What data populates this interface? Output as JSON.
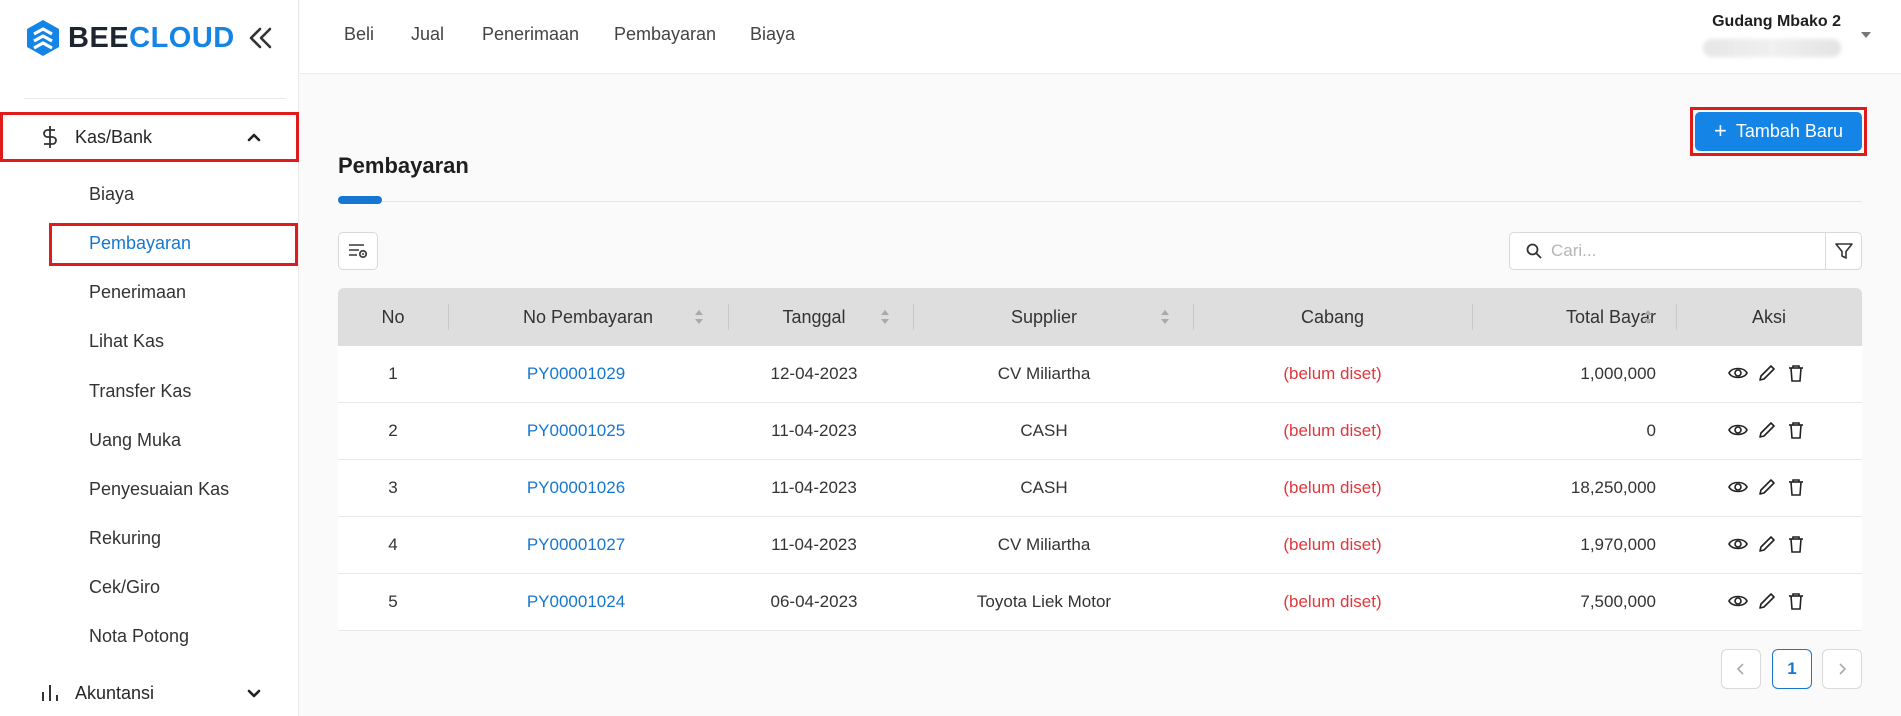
{
  "brand": {
    "part1": "BEE",
    "part2": "CLOUD"
  },
  "sidebar": {
    "kas_bank": {
      "label": "Kas/Bank",
      "icon": "dollar-icon"
    },
    "items": [
      {
        "label": "Biaya"
      },
      {
        "label": "Pembayaran"
      },
      {
        "label": "Penerimaan"
      },
      {
        "label": "Lihat Kas"
      },
      {
        "label": "Transfer Kas"
      },
      {
        "label": "Uang Muka"
      },
      {
        "label": "Penyesuaian Kas"
      },
      {
        "label": "Rekuring"
      },
      {
        "label": "Cek/Giro"
      },
      {
        "label": "Nota Potong"
      }
    ],
    "akuntansi": {
      "label": "Akuntansi",
      "icon": "bar-chart-icon"
    }
  },
  "topnav": {
    "items": [
      "Beli",
      "Jual",
      "Penerimaan",
      "Pembayaran",
      "Biaya"
    ],
    "user_name": "Gudang Mbako 2"
  },
  "page": {
    "title": "Pembayaran",
    "add_button": "Tambah Baru",
    "search_placeholder": "Cari..."
  },
  "table": {
    "headers": [
      "No",
      "No Pembayaran",
      "Tanggal",
      "Supplier",
      "Cabang",
      "Total Bayar",
      "Aksi"
    ],
    "rows": [
      {
        "no": "1",
        "code": "PY00001029",
        "date": "12-04-2023",
        "supplier": "CV Miliartha",
        "cabang": "(belum diset)",
        "total": "1,000,000"
      },
      {
        "no": "2",
        "code": "PY00001025",
        "date": "11-04-2023",
        "supplier": "CASH",
        "cabang": "(belum diset)",
        "total": "0"
      },
      {
        "no": "3",
        "code": "PY00001026",
        "date": "11-04-2023",
        "supplier": "CASH",
        "cabang": "(belum diset)",
        "total": "18,250,000"
      },
      {
        "no": "4",
        "code": "PY00001027",
        "date": "11-04-2023",
        "supplier": "CV Miliartha",
        "cabang": "(belum diset)",
        "total": "1,970,000"
      },
      {
        "no": "5",
        "code": "PY00001024",
        "date": "06-04-2023",
        "supplier": "Toyota Liek Motor",
        "cabang": "(belum diset)",
        "total": "7,500,000"
      }
    ]
  },
  "pagination": {
    "current": "1"
  },
  "colors": {
    "accent": "#1677d2",
    "button": "#1484e6",
    "highlight": "#e01b1b",
    "warn": "#e2363b"
  }
}
